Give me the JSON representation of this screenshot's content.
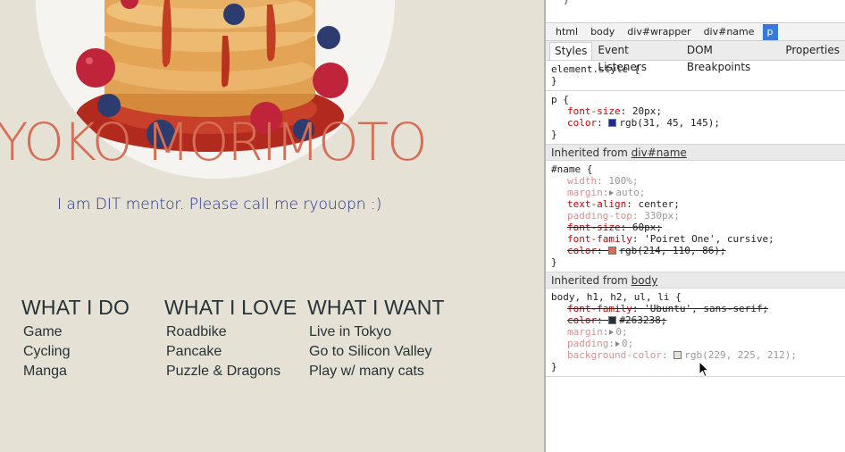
{
  "page": {
    "name_title": "YOKO MORIMOTO",
    "intro": "I am DIT mentor. Please call me ryouopn :)",
    "columns": [
      {
        "heading": "WHAT I DO",
        "items": [
          "Game",
          "Cycling",
          "Manga"
        ]
      },
      {
        "heading": "WHAT I LOVE",
        "items": [
          "Roadbike",
          "Pancake",
          "Puzzle & Dragons"
        ]
      },
      {
        "heading": "WHAT I WANT",
        "items": [
          "Live in Tokyo",
          "Go to Silicon Valley",
          "Play w/ many cats"
        ]
      }
    ]
  },
  "devtools": {
    "top_fragment": "}",
    "breadcrumbs": [
      "html",
      "body",
      "div#wrapper",
      "div#name",
      "p"
    ],
    "tabs": [
      "Styles",
      "Event Listeners",
      "DOM Breakpoints",
      "Properties"
    ],
    "element_style": {
      "selector": "element.style {",
      "close": "}"
    },
    "p_rule": {
      "selector": "p {",
      "props": [
        {
          "name": "font-size",
          "value": "20px;"
        },
        {
          "name": "color",
          "value": "rgb(31, 45, 145);",
          "swatch": "#1f2d91"
        }
      ],
      "close": "}"
    },
    "inherited_name": {
      "label": "Inherited from ",
      "link": "div#name"
    },
    "name_rule": {
      "selector": "#name {",
      "props": [
        {
          "name": "width",
          "value": "100%;"
        },
        {
          "name": "margin",
          "value": "auto;"
        },
        {
          "name": "text-align",
          "value": "center;"
        },
        {
          "name": "padding-top",
          "value": "330px;"
        },
        {
          "name": "font-size",
          "value": "60px;"
        },
        {
          "name": "font-family",
          "value": "'Poiret One', cursive;"
        },
        {
          "name": "color",
          "value": "rgb(214, 110, 86);",
          "swatch": "#d66e56"
        }
      ],
      "close": "}"
    },
    "inherited_body": {
      "label": "Inherited from ",
      "link": "body"
    },
    "body_rule": {
      "selector": "body, h1, h2, ul, li {",
      "props": [
        {
          "name": "font-family",
          "value": "'Ubuntu', sans-serif;"
        },
        {
          "name": "color",
          "value": "#263238;",
          "swatch": "#263238"
        },
        {
          "name": "margin",
          "value": "0;"
        },
        {
          "name": "padding",
          "value": "0;"
        },
        {
          "name": "background-color",
          "value": "rgb(229, 225, 212);",
          "swatch": "#e5e1d4"
        }
      ],
      "close": "}"
    }
  }
}
